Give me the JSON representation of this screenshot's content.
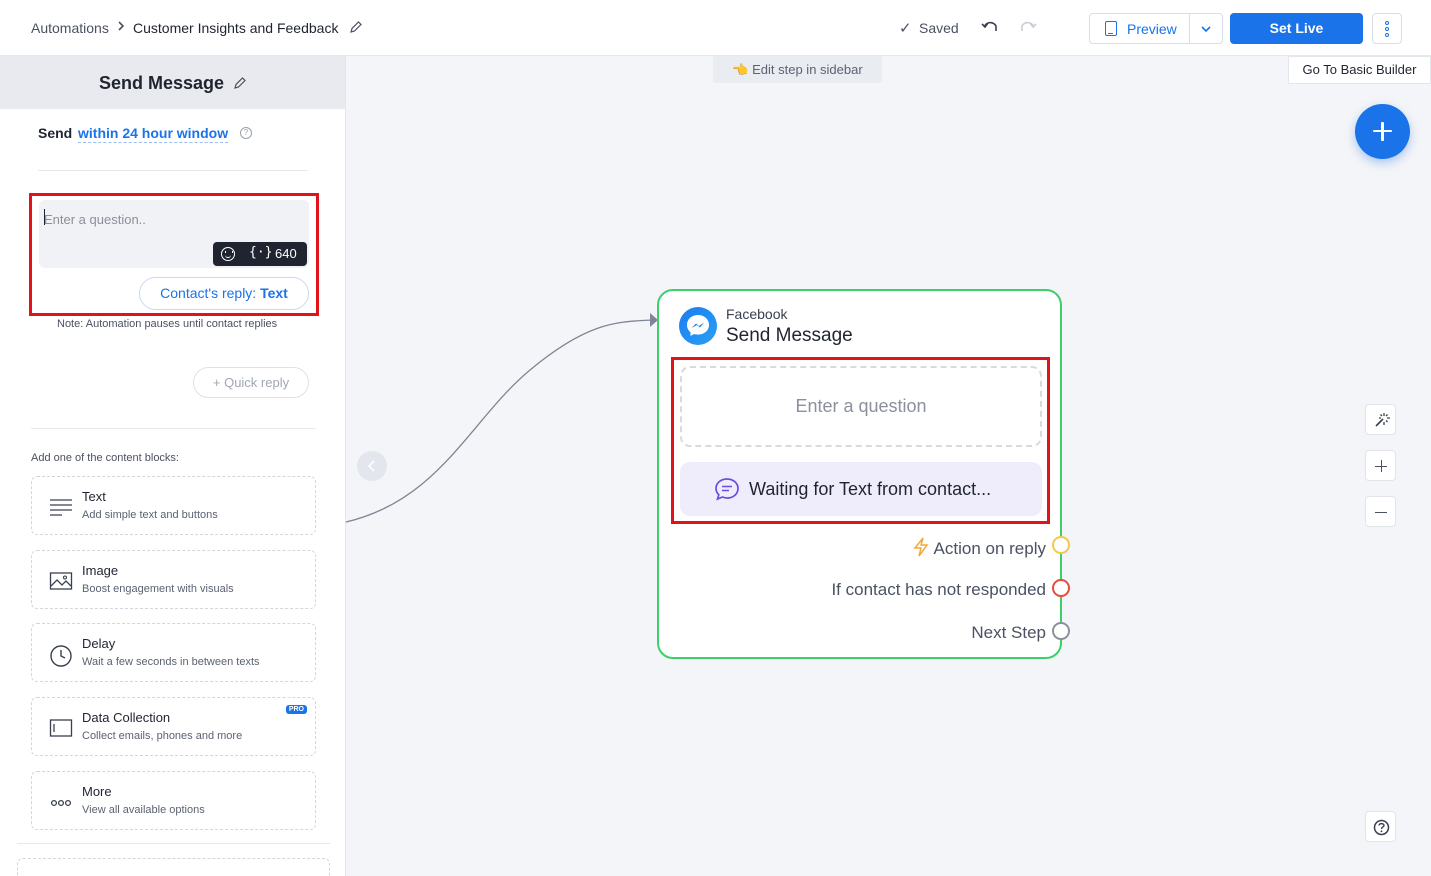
{
  "breadcrumb": {
    "root": "Automations",
    "separator": ">",
    "current": "Customer Insights and Feedback"
  },
  "status": {
    "saved_label": "Saved",
    "check": "✓"
  },
  "toolbar": {
    "preview_label": "Preview",
    "set_live_label": "Set Live"
  },
  "canvas": {
    "edit_hint": "👈 Edit step in sidebar",
    "basic_builder_label": "Go To Basic Builder"
  },
  "sidebar": {
    "title": "Send Message",
    "send_label": "Send",
    "send_window": "within 24 hour window",
    "question": {
      "placeholder": "Enter a question..",
      "char_count": "640",
      "variable_icon": "{·}"
    },
    "reply": {
      "label": "Contact's reply: ",
      "value": "Text"
    },
    "note": "Note: Automation pauses until contact replies",
    "quick_reply_label": "+ Quick reply",
    "blocks_heading": "Add one of the content blocks:",
    "blocks": [
      {
        "title": "Text",
        "description": "Add simple text and buttons",
        "icon": "lines-icon"
      },
      {
        "title": "Image",
        "description": "Boost engagement with visuals",
        "icon": "image-icon"
      },
      {
        "title": "Delay",
        "description": "Wait a few seconds in between texts",
        "icon": "clock-icon"
      },
      {
        "title": "Data Collection",
        "description": "Collect emails, phones and more",
        "icon": "form-icon",
        "badge": "PRO"
      },
      {
        "title": "More",
        "description": "View all available options",
        "icon": "more-icon"
      }
    ]
  },
  "node": {
    "channel": "Facebook",
    "title": "Send Message",
    "question_placeholder": "Enter a question",
    "waiting_text": "Waiting for Text from contact...",
    "outputs": [
      {
        "label": "Action on reply",
        "color": "#f5c84a"
      },
      {
        "label": "If contact has not responded",
        "color": "#e94b3c"
      },
      {
        "label": "Next Step",
        "color": "#8a909c"
      }
    ]
  },
  "colors": {
    "accent": "#1a73e8",
    "node_border": "#3ccf6a",
    "highlight": "#e0131b",
    "waiting_bg": "#efedfc"
  }
}
